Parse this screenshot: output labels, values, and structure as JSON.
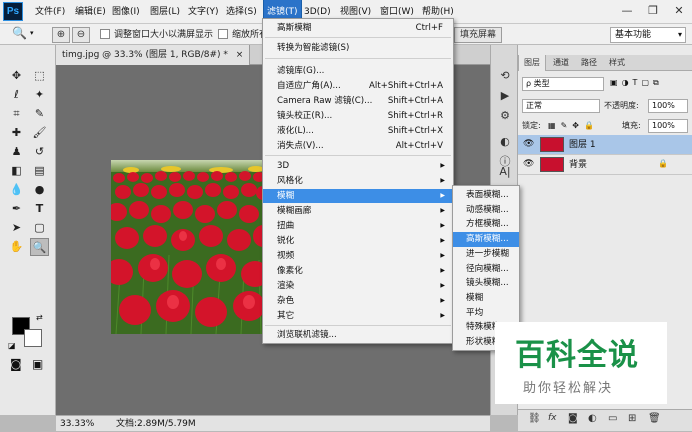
{
  "app": {
    "logo": "Ps"
  },
  "menubar": {
    "items": [
      "文件(F)",
      "编辑(E)",
      "图像(I)",
      "图层(L)",
      "文字(Y)",
      "选择(S)",
      "滤镜(T)",
      "3D(D)",
      "视图(V)",
      "窗口(W)",
      "帮助(H)"
    ],
    "active": "滤镜(T)"
  },
  "window_controls": {
    "minimize": "—",
    "restore": "❐",
    "close": "✕"
  },
  "options_bar": {
    "resize_windows": "调整窗口大小以满屏显示",
    "zoom_all": "缩放所有",
    "fill_screen": "填充屏幕",
    "workspace": "基本功能"
  },
  "document": {
    "tab": "timg.jpg @ 33.3% (图层 1, RGB/8#) *",
    "tab_close": "×"
  },
  "status": {
    "zoom": "33.33%",
    "doc": "文档:2.89M/5.79M"
  },
  "filter_menu": {
    "items": [
      {
        "label": "高斯模糊",
        "shortcut": "Ctrl+F"
      },
      {
        "label": "转换为智能滤镜(S)"
      },
      {
        "label": "滤镜库(G)..."
      },
      {
        "label": "自适应广角(A)...",
        "shortcut": "Alt+Shift+Ctrl+A"
      },
      {
        "label": "Camera Raw 滤镜(C)...",
        "shortcut": "Shift+Ctrl+A"
      },
      {
        "label": "镜头校正(R)...",
        "shortcut": "Shift+Ctrl+R"
      },
      {
        "label": "液化(L)...",
        "shortcut": "Shift+Ctrl+X"
      },
      {
        "label": "消失点(V)...",
        "shortcut": "Alt+Ctrl+V"
      },
      {
        "label": "3D",
        "sub": true
      },
      {
        "label": "风格化",
        "sub": true
      },
      {
        "label": "模糊",
        "sub": true,
        "highlight": true
      },
      {
        "label": "模糊画廊",
        "sub": true
      },
      {
        "label": "扭曲",
        "sub": true
      },
      {
        "label": "锐化",
        "sub": true
      },
      {
        "label": "视频",
        "sub": true
      },
      {
        "label": "像素化",
        "sub": true
      },
      {
        "label": "渲染",
        "sub": true
      },
      {
        "label": "杂色",
        "sub": true
      },
      {
        "label": "其它",
        "sub": true
      },
      {
        "label": "浏览联机滤镜..."
      }
    ]
  },
  "blur_submenu": {
    "items": [
      "表面模糊...",
      "动感模糊...",
      "方框模糊...",
      "高斯模糊...",
      "进一步模糊",
      "径向模糊...",
      "镜头模糊...",
      "模糊",
      "平均",
      "特殊模糊...",
      "形状模糊..."
    ],
    "highlight": "高斯模糊..."
  },
  "layers_panel": {
    "tabs": [
      "图层",
      "通道",
      "路径",
      "样式"
    ],
    "filter_kind": "ρ 类型",
    "blend_mode": "正常",
    "opacity_label": "不透明度:",
    "opacity": "100%",
    "lock_label": "锁定:",
    "fill_label": "填充:",
    "fill": "100%",
    "layers": [
      {
        "name": "图层 1",
        "selected": true
      },
      {
        "name": "背景",
        "locked": true
      }
    ],
    "footer_icons": [
      "link-icon",
      "fx-icon",
      "mask-icon",
      "adjustment-icon",
      "group-icon",
      "new-layer-icon",
      "trash-icon"
    ],
    "footer_fx": "fx"
  },
  "watermark": {
    "main": "百科全说",
    "sub": "助你轻松解决",
    "color": "#1a9148"
  },
  "colors": {
    "menu_highlight": "#3d8ee6",
    "tulip_red": "#d3142a"
  }
}
